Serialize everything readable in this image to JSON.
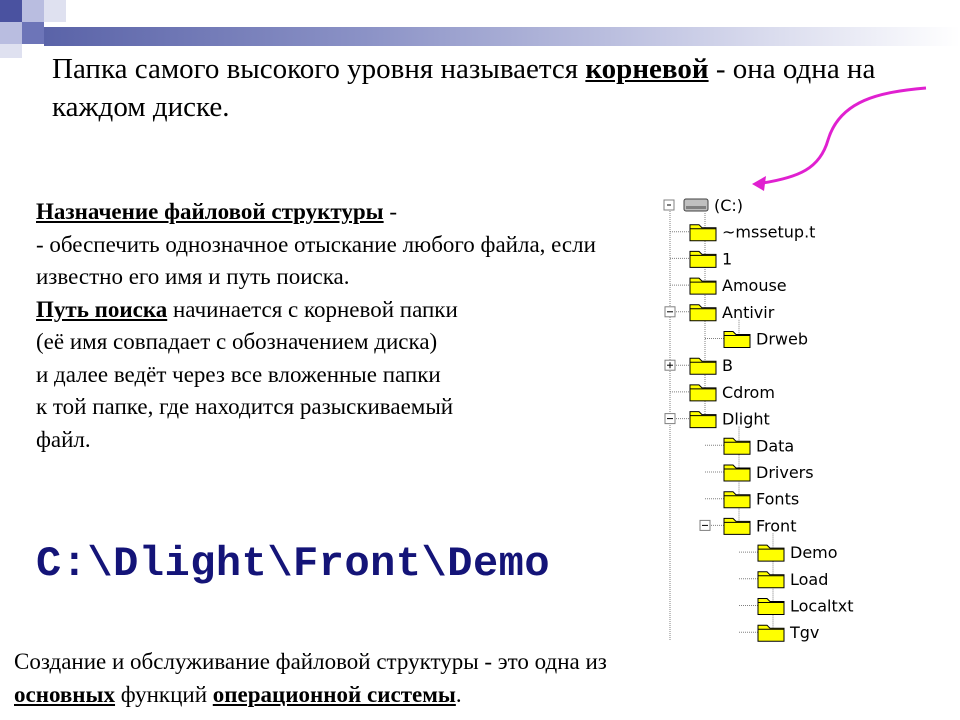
{
  "slide": {
    "title_part1": "Папка самого высокого уровня называется ",
    "title_bold": "корневой",
    "title_part2": " - она одна на каждом диске.",
    "purpose_term": "Назначение файловой структуры",
    "purpose_dash": " -",
    "purpose_text": "-  обеспечить однозначное отыскание любого файла, если известно его имя и путь поиска.",
    "path_term": "Путь поиска",
    "path_text_1": " начинается с корневой папки",
    "path_text_2": "(её имя совпадает с обозначением диска)",
    "path_text_3": "и далее ведёт через все вложенные папки",
    "path_text_4": "к той папке, где находится разыскиваемый",
    "path_text_5": "файл.",
    "example_path": "C:\\Dlight\\Front\\Demo",
    "bottom_1": "Создание и обслуживание файловой структуры - это одна из",
    "bottom_term1": "основных",
    "bottom_mid": " функций ",
    "bottom_term2": "операционной системы",
    "bottom_end": "."
  },
  "tree": {
    "root": "(C:)",
    "items": [
      {
        "label": "~mssetup.t"
      },
      {
        "label": "1"
      },
      {
        "label": "Amouse"
      },
      {
        "label": "Antivir"
      },
      {
        "label": "Drweb"
      },
      {
        "label": "B"
      },
      {
        "label": "Cdrom"
      },
      {
        "label": "Dlight"
      },
      {
        "label": "Data"
      },
      {
        "label": "Drivers"
      },
      {
        "label": "Fonts"
      },
      {
        "label": "Front"
      },
      {
        "label": "Demo"
      },
      {
        "label": "Load"
      },
      {
        "label": "Localtxt"
      },
      {
        "label": "Tgv"
      }
    ]
  },
  "colors": {
    "arrow": "#e020d0",
    "path": "#141478",
    "folder": "#ffff00"
  }
}
